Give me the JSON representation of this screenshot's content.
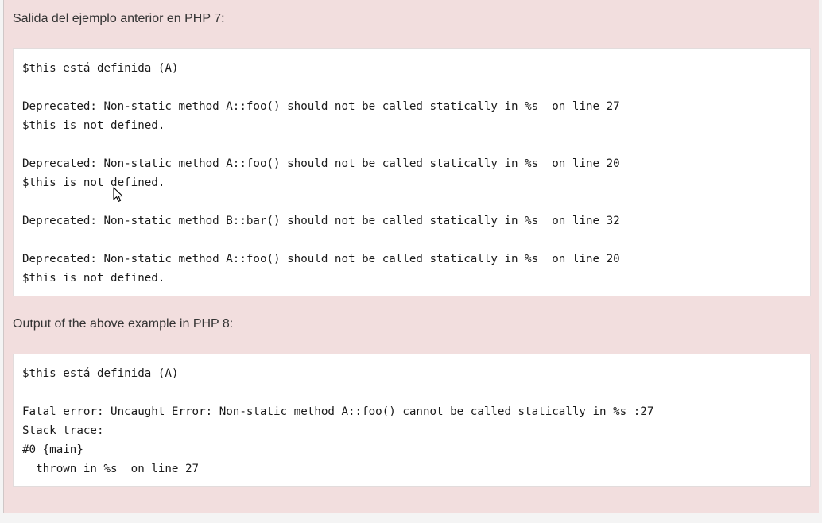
{
  "php7_section": {
    "heading": "Salida del ejemplo anterior en PHP 7:",
    "output_lines": [
      "$this está definida (A)",
      "",
      "Deprecated: Non-static method A::foo() should not be called statically in %s  on line 27",
      "$this is not defined.",
      "",
      "Deprecated: Non-static method A::foo() should not be called statically in %s  on line 20",
      "$this is not defined.",
      "",
      "Deprecated: Non-static method B::bar() should not be called statically in %s  on line 32",
      "",
      "Deprecated: Non-static method A::foo() should not be called statically in %s  on line 20",
      "$this is not defined."
    ]
  },
  "php8_section": {
    "heading": "Output of the above example in PHP 8:",
    "output_lines": [
      "$this está definida (A)",
      "",
      "Fatal error: Uncaught Error: Non-static method A::foo() cannot be called statically in %s :27",
      "Stack trace:",
      "#0 {main}",
      "  thrown in %s  on line 27"
    ]
  },
  "colors": {
    "panel_background": "#f2dede",
    "code_background": "#ffffff",
    "text": "#333333"
  },
  "icons": {
    "cursor": "mouse-pointer-icon"
  }
}
